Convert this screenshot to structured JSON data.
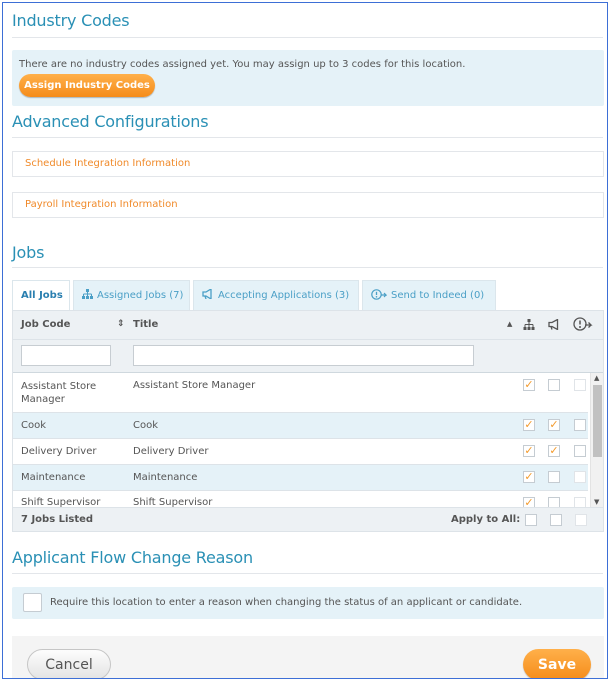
{
  "industry_codes": {
    "title": "Industry Codes",
    "notice": "There are no industry codes assigned yet. You may assign up to 3 codes for this location.",
    "assign_button": "Assign Industry Codes"
  },
  "advanced": {
    "title": "Advanced Configurations",
    "links": [
      "Schedule Integration Information",
      "Payroll Integration Information"
    ]
  },
  "jobs": {
    "title": "Jobs",
    "tabs": [
      {
        "label": "All Jobs",
        "icon": ""
      },
      {
        "label": "Assigned Jobs (7)",
        "icon": "org-chart-icon"
      },
      {
        "label": "Accepting Applications (3)",
        "icon": "megaphone-icon"
      },
      {
        "label": "Send to Indeed (0)",
        "icon": "indeed-send-icon"
      }
    ],
    "columns": {
      "job_code": "Job Code",
      "title": "Title",
      "sort_glyph": "⇕",
      "sort_up_glyph": "▲"
    },
    "rows": [
      {
        "code": "Assistant Store Manager",
        "title": "Assistant Store Manager",
        "assigned": true,
        "accepting": false,
        "indeed": false
      },
      {
        "code": "Cook",
        "title": "Cook",
        "assigned": true,
        "accepting": true,
        "indeed": false
      },
      {
        "code": "Delivery Driver",
        "title": "Delivery Driver",
        "assigned": true,
        "accepting": true,
        "indeed": false
      },
      {
        "code": "Maintenance",
        "title": "Maintenance",
        "assigned": true,
        "accepting": false,
        "indeed": false
      },
      {
        "code": "Shift Supervisor",
        "title": "Shift Supervisor",
        "assigned": true,
        "accepting": false,
        "indeed": false
      }
    ],
    "footer_count": "7 Jobs Listed",
    "apply_to_all": "Apply to All:"
  },
  "applicant_flow": {
    "title": "Applicant Flow Change Reason",
    "checkbox_label": "Require this location to enter a reason when changing the status of an applicant or candidate."
  },
  "footer": {
    "cancel": "Cancel",
    "save": "Save"
  },
  "colors": {
    "accent_teal": "#2a90b5",
    "orange": "#f58c1a",
    "frame_blue": "#3d6fd6"
  }
}
